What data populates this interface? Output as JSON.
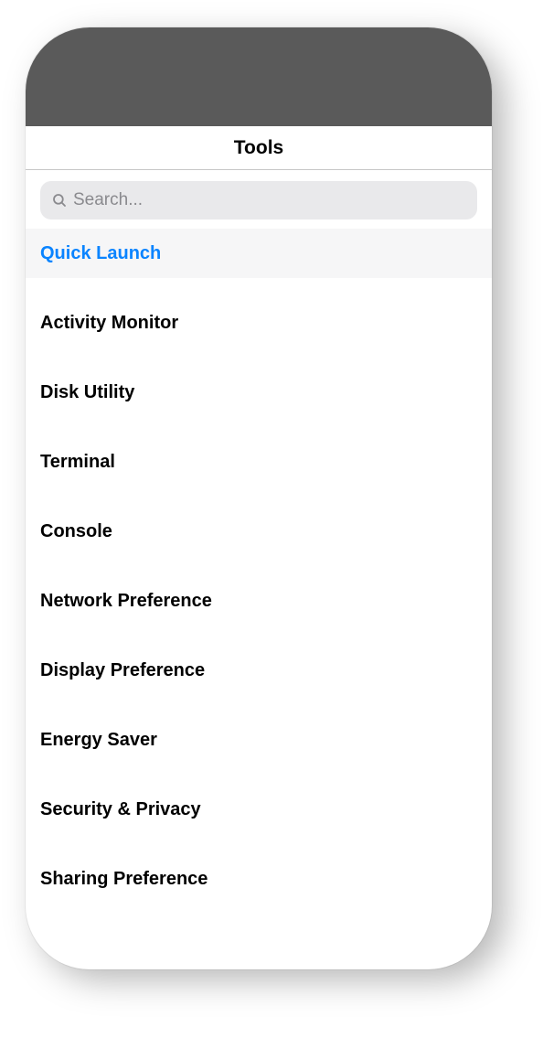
{
  "header": {
    "title": "Tools"
  },
  "search": {
    "placeholder": "Search...",
    "value": ""
  },
  "list": {
    "items": [
      {
        "label": "Quick Launch",
        "selected": true
      },
      {
        "label": "Activity Monitor",
        "selected": false
      },
      {
        "label": "Disk Utility",
        "selected": false
      },
      {
        "label": "Terminal",
        "selected": false
      },
      {
        "label": "Console",
        "selected": false
      },
      {
        "label": "Network Preference",
        "selected": false
      },
      {
        "label": "Display Preference",
        "selected": false
      },
      {
        "label": "Energy Saver",
        "selected": false
      },
      {
        "label": "Security & Privacy",
        "selected": false
      },
      {
        "label": "Sharing Preference",
        "selected": false
      }
    ]
  },
  "colors": {
    "accent": "#0a84ff",
    "statusbar": "#5a5a5a",
    "searchBg": "#e9e9eb"
  }
}
